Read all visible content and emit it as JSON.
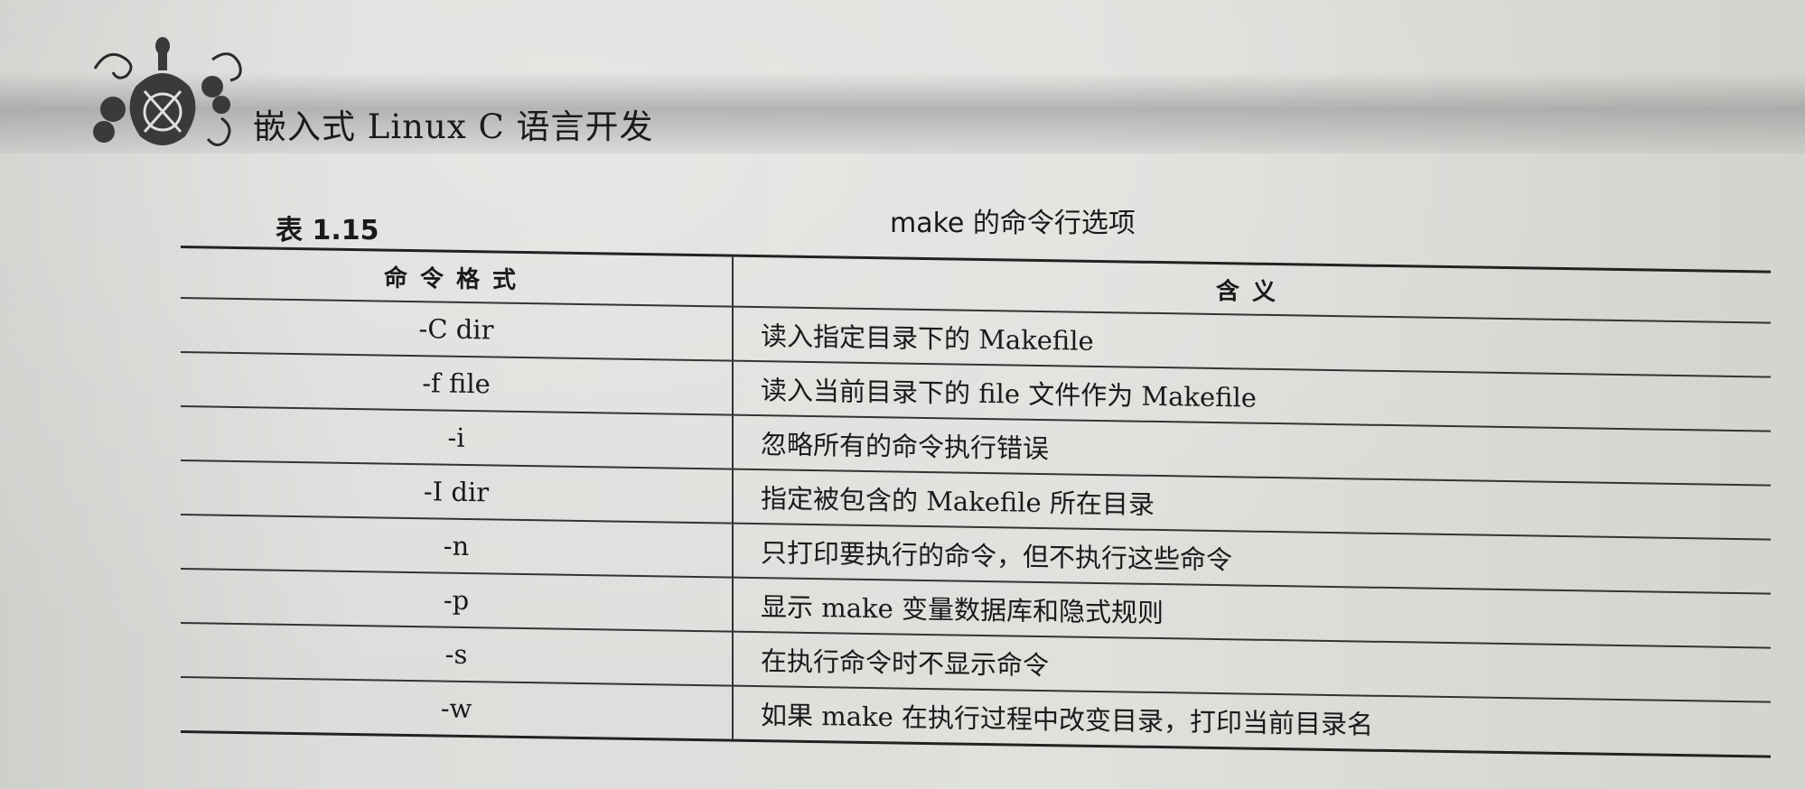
{
  "header": {
    "running_title": "嵌入式 Linux C 语言开发"
  },
  "caption": {
    "number": "表 1.15",
    "title": "make 的命令行选项"
  },
  "table": {
    "columns": [
      "命令格式",
      "含义"
    ],
    "rows": [
      {
        "cmd": "-C dir",
        "desc": "读入指定目录下的 Makefile"
      },
      {
        "cmd": "-f file",
        "desc": "读入当前目录下的 file 文件作为 Makefile"
      },
      {
        "cmd": "-i",
        "desc": "忽略所有的命令执行错误"
      },
      {
        "cmd": "-I dir",
        "desc": "指定被包含的 Makefile 所在目录"
      },
      {
        "cmd": "-n",
        "desc": "只打印要执行的命令，但不执行这些命令"
      },
      {
        "cmd": "-p",
        "desc": "显示 make 变量数据库和隐式规则"
      },
      {
        "cmd": "-s",
        "desc": "在执行命令时不显示命令"
      },
      {
        "cmd": "-w",
        "desc": "如果 make 在执行过程中改变目录，打印当前目录名"
      }
    ]
  }
}
